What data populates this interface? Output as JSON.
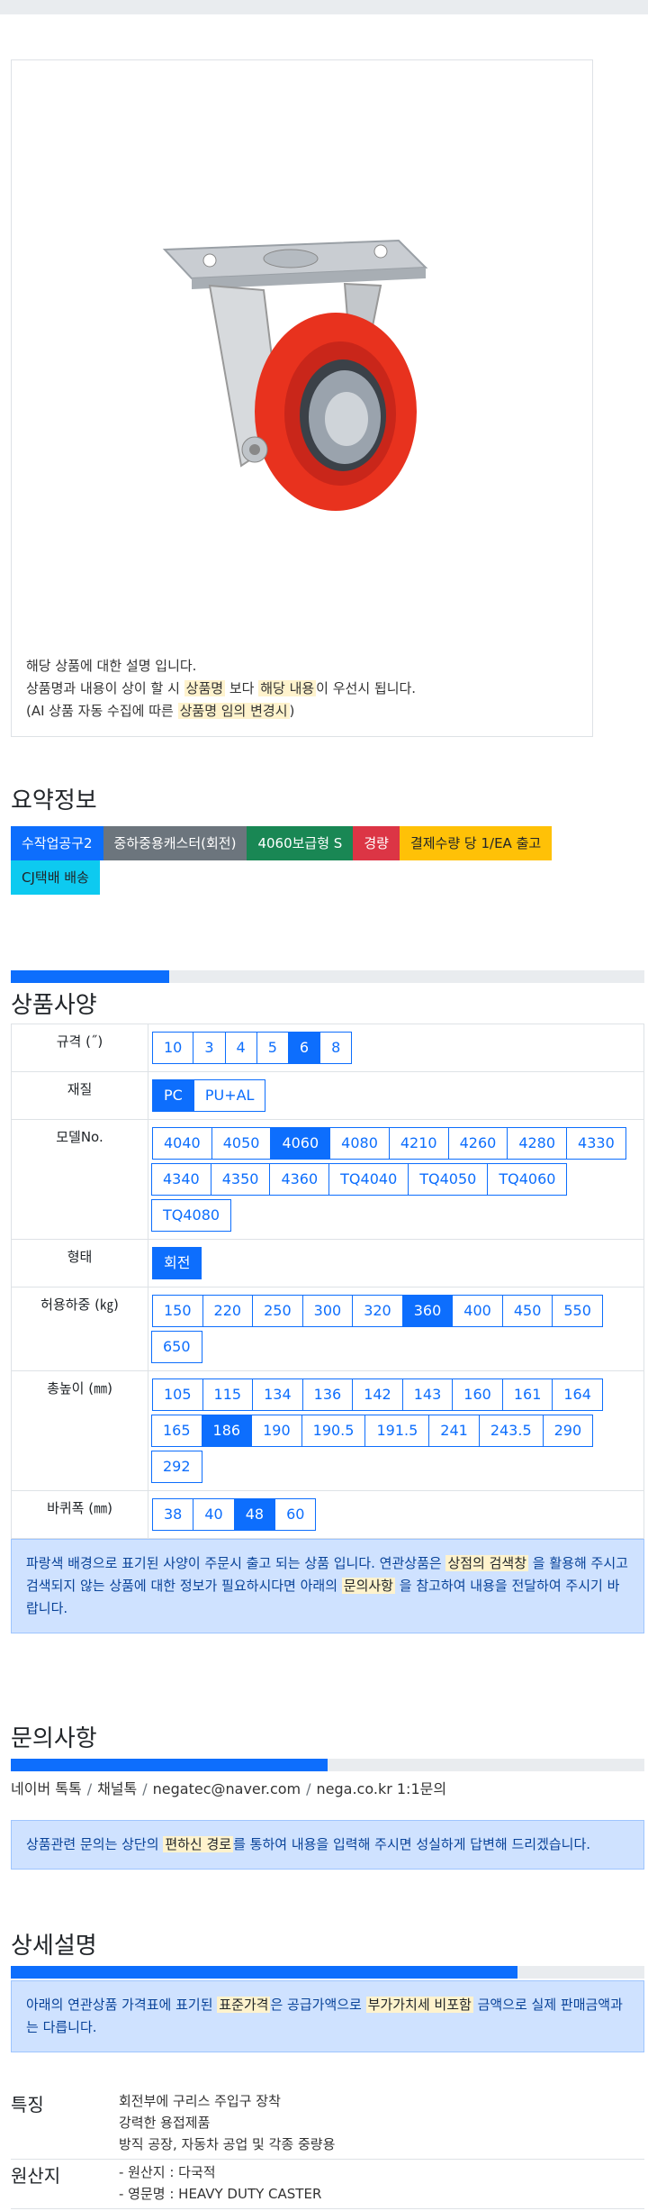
{
  "image_note": {
    "line1": "해당 상품에 대한 설명 입니다.",
    "line2_pre": "상품명과 내용이 상이 할 시 ",
    "line2_hl1": "상품명",
    "line2_mid": " 보다 ",
    "line2_hl2": "해당 내용",
    "line2_post": "이 우선시 됩니다.",
    "line3_pre": "(AI 상품 자동 수집에 따른 ",
    "line3_hl": "상품명 임의 변경시",
    "line3_post": ")"
  },
  "summary": {
    "title": "요약정보",
    "badges": [
      {
        "label": "수작업공구2",
        "color": "blue"
      },
      {
        "label": "중하중용캐스터(회전)",
        "color": "gray"
      },
      {
        "label": "4060보급형 S",
        "color": "green"
      },
      {
        "label": "경량",
        "color": "red"
      },
      {
        "label": "결제수량 당 1/EA 출고",
        "color": "yellow"
      },
      {
        "label": "CJ택배 배송",
        "color": "cyan"
      }
    ]
  },
  "spec": {
    "progress": 0.25,
    "title": "상품사양",
    "rows": [
      {
        "label": "규격 (˝)",
        "options": [
          "10",
          "3",
          "4",
          "5",
          "6",
          "8"
        ],
        "selected": "6"
      },
      {
        "label": "재질",
        "options": [
          "PC",
          "PU+AL"
        ],
        "selected": "PC"
      },
      {
        "label": "모델No.",
        "options": [
          "4040",
          "4050",
          "4060",
          "4080",
          "4210",
          "4260",
          "4280",
          "4330",
          "4340",
          "4350",
          "4360",
          "TQ4040",
          "TQ4050",
          "TQ4060",
          "TQ4080"
        ],
        "selected": "4060"
      },
      {
        "label": "형태",
        "options": [
          "회전"
        ],
        "selected": "회전"
      },
      {
        "label": "허용하중 (㎏)",
        "options": [
          "150",
          "220",
          "250",
          "300",
          "320",
          "360",
          "400",
          "450",
          "550",
          "650"
        ],
        "selected": "360"
      },
      {
        "label": "총높이 (㎜)",
        "options": [
          "105",
          "115",
          "134",
          "136",
          "142",
          "143",
          "160",
          "161",
          "164",
          "165",
          "186",
          "190",
          "190.5",
          "191.5",
          "241",
          "243.5",
          "290",
          "292"
        ],
        "selected": "186"
      },
      {
        "label": "바퀴폭 (㎜)",
        "options": [
          "38",
          "40",
          "48",
          "60"
        ],
        "selected": "48"
      }
    ],
    "notice_pre": "파랑색 배경으로 표기된 사양이 주문시 출고 되는 상품 입니다. 연관상품은 ",
    "notice_hl1": "상점의 검색창",
    "notice_mid": " 을 활용해 주시고 검색되지 않는 상품에 대한 정보가 필요하시다면 아래의 ",
    "notice_hl2": "문의사항",
    "notice_post": " 을 참고하여 내용을 전달하여 주시기 바랍니다."
  },
  "inquiry": {
    "progress": 0.5,
    "title": "문의사항",
    "links": [
      "네이버 톡톡",
      "채널톡",
      "negatec@naver.com",
      "nega.co.kr 1:1문의"
    ],
    "notice_pre": "상품관련 문의는 상단의 ",
    "notice_hl": "편하신 경로",
    "notice_post": "를 통하여 내용을 입력해 주시면 성실하게 답변해 드리겠습니다."
  },
  "detail": {
    "progress": 0.8,
    "title": "상세설명",
    "notice_pre": "아래의 연관상품 가격표에 표기된 ",
    "notice_hl1": "표준가격",
    "notice_mid": "은 공급가액으로 ",
    "notice_hl2": "부가가치세 비포함",
    "notice_post": " 금액으로 실제 판매금액과는 다릅니다.",
    "features": [
      {
        "label": "특징",
        "values": [
          "회전부에 구리스 주입구 장착",
          "강력한 용접제품",
          "방직 공장, 자동차 공업 및 각종 중량용"
        ]
      },
      {
        "label": "원산지",
        "values": [
          "- 원산지 : 다국적",
          "- 영문명 : HEAVY DUTY CASTER"
        ]
      }
    ]
  },
  "colors": {
    "accent": "#0d6efd",
    "caster_wheel": "#e8321e",
    "plate": "#c9cdd2"
  }
}
